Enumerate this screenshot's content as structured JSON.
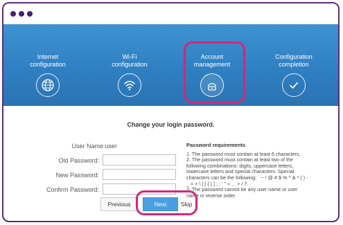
{
  "steps": [
    {
      "label_line1": "Internet",
      "label_line2": "configuration",
      "icon": "globe-icon"
    },
    {
      "label_line1": "Wi-Fi",
      "label_line2": "configuration",
      "icon": "wifi-icon"
    },
    {
      "label_line1": "Account",
      "label_line2": "management",
      "icon": "router-account-icon"
    },
    {
      "label_line1": "Configuration",
      "label_line2": "completion",
      "icon": "check-icon"
    }
  ],
  "form": {
    "title": "Change your login password.",
    "user_name_label": "User Name:",
    "user_name_value": "user",
    "old_password_label": "Old Password:",
    "new_password_label": "New Password:",
    "confirm_password_label": "Confirm Password:"
  },
  "requirements": {
    "title": "Password requirements",
    "items": [
      "1. The password must contain at least 6 characters.",
      "2. The password must contain at least two of the following combinations: digits, uppercase letters, lowercase letters and special characters. Special characters can be the following: ` ~ ! @ # $ % ^ & * ( ) - _ = + \\ | [ { } ] ; : ' \" < , . > / ?.",
      "3. The password cannot be any user name or user name in reverse order."
    ]
  },
  "buttons": {
    "previous": "Previous",
    "next": "Next",
    "skip": "Skip"
  },
  "colors": {
    "banner": "#2f80c2",
    "highlight": "#d6257a",
    "next_button": "#4a9fe0",
    "frame": "#5b2a86"
  }
}
